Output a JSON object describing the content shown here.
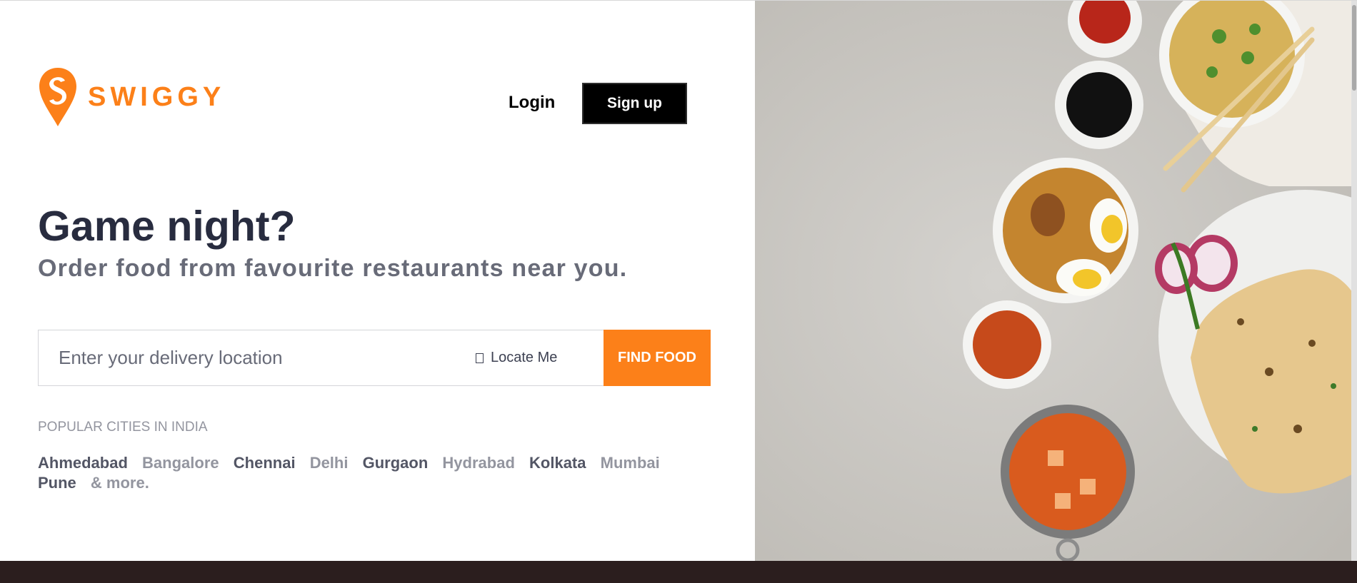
{
  "brand": {
    "name": "SWIGGY",
    "color": "#fc8019"
  },
  "header": {
    "login_label": "Login",
    "signup_label": "Sign up"
  },
  "hero_text": {
    "title": "Game night?",
    "subtitle": "Order food from favourite restaurants near you."
  },
  "search": {
    "placeholder": "Enter your delivery location",
    "value": "",
    "locate_label": "Locate Me",
    "locate_icon": "location-icon",
    "button_label": "FIND FOOD"
  },
  "popular": {
    "label": "POPULAR CITIES IN INDIA",
    "cities": [
      "Ahmedabad",
      "Bangalore",
      "Chennai",
      "Delhi",
      "Gurgaon",
      "Hydrabad",
      "Kolkata",
      "Mumbai",
      "Pune"
    ],
    "more_label": "& more."
  },
  "hero_image": {
    "icon": "food-spread-image"
  },
  "colors": {
    "accent": "#fc8019",
    "heading": "#282c3f",
    "subtext": "#686b78",
    "footer": "#2b1e1e"
  }
}
